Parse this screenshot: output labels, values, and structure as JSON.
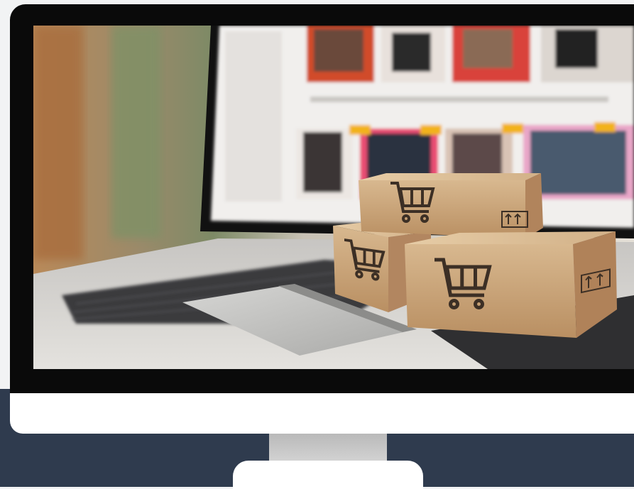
{
  "scene": {
    "subject": "monitor-mockup",
    "screen_content": "online-shopping-photo",
    "icons": [
      "shopping-cart-icon",
      "fragile-handle-with-care-icon"
    ],
    "colors": {
      "page_background": "#f2f3f4",
      "bottom_band": "#2f3b4e",
      "monitor_bezel": "#0a0a0a",
      "monitor_chin": "#ffffff",
      "stand_neck": "#c4c4c4",
      "cardboard": "#c9a57a",
      "cart_print": "#3c2f25"
    }
  }
}
